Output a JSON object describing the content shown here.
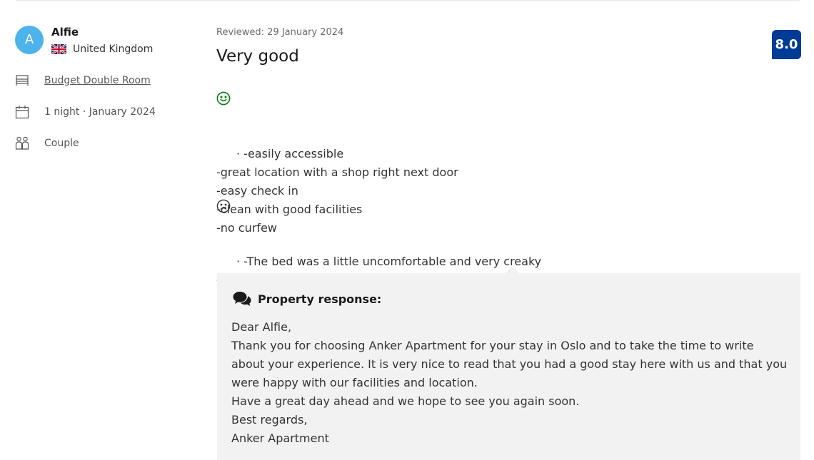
{
  "reviewer": {
    "initial": "A",
    "name": "Alfie",
    "country": "United Kingdom",
    "avatar_color": "#4db3ea"
  },
  "stay": {
    "room": "Budget Double Room",
    "duration": "1 night · January 2024",
    "traveler_type": "Couple",
    "icons": [
      "bed-icon",
      "calendar-icon",
      "people-icon"
    ]
  },
  "review": {
    "date": "Reviewed: 29 January 2024",
    "title": "Very good",
    "score": "8.0",
    "score_color": "#003b95",
    "positive_icon": "smile-face-icon",
    "positive_color": "#008009",
    "positive": "· -easily accessible\n-great location with a shop right next door\n-easy check in\n-clean with good facilities\n-no curfew",
    "negative_icon": "frown-face-icon",
    "negative": "· -The bed was a little uncomfortable and very creaky\n-The walls were also thin and you could hear quite a lot going on especially as it's part of a student accommodation."
  },
  "response": {
    "icon": "chat-bubbles-icon",
    "heading": "Property response:",
    "text": "Dear Alfie,\nThank you for choosing Anker Apartment for your stay in Oslo and to take the time to write about your experience. It is very nice to read that you had a good stay here with us and that you were happy with our facilities and location.\nHave a great day ahead and we hope to see you again soon.\nBest regards,\nAnker Apartment"
  }
}
